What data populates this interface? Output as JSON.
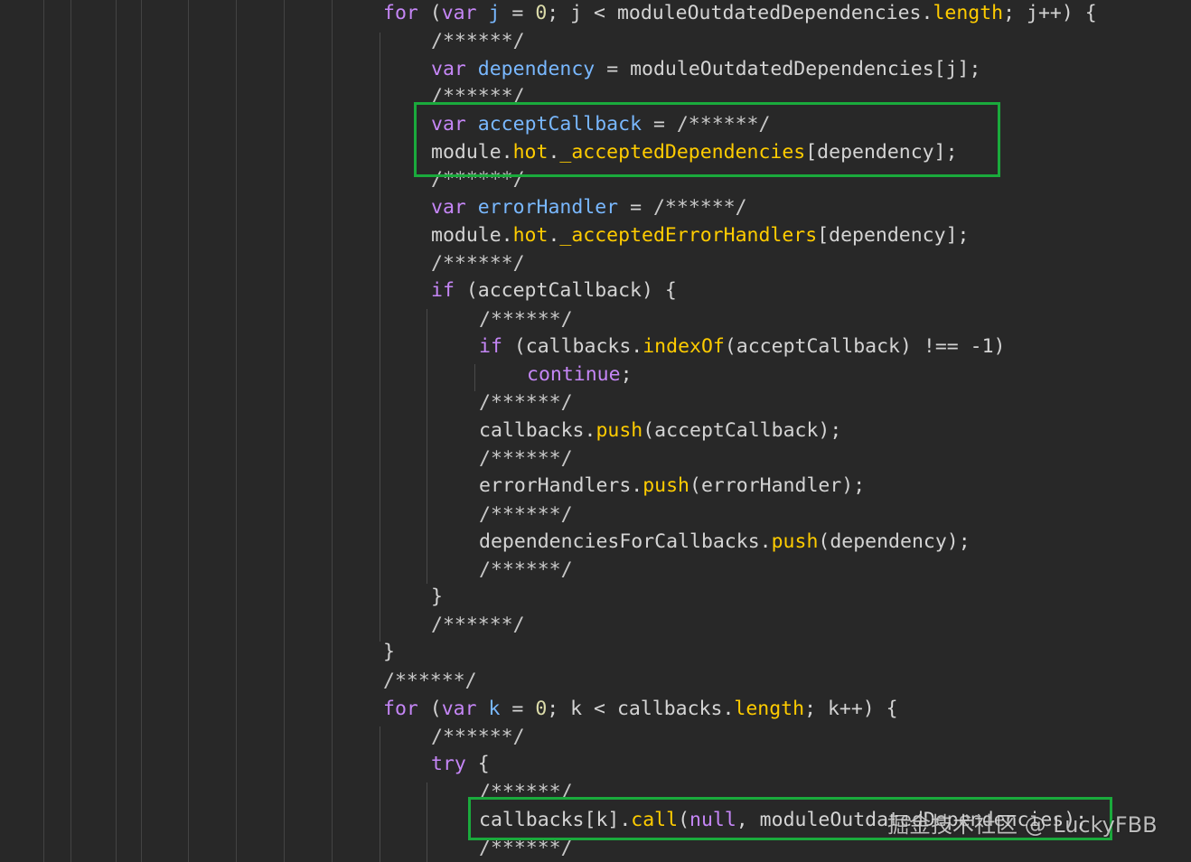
{
  "editor": {
    "lines": [
      {
        "tokens": [
          [
            "kw",
            "for"
          ],
          [
            "plain",
            " ("
          ],
          [
            "kw",
            "var"
          ],
          [
            "plain",
            " "
          ],
          [
            "var",
            "j"
          ],
          [
            "op",
            " = "
          ],
          [
            "num",
            "0"
          ],
          [
            "plain",
            "; j < moduleOutdatedDependencies."
          ],
          [
            "fn",
            "length"
          ],
          [
            "plain",
            "; j++) {"
          ]
        ]
      },
      {
        "tokens": [
          [
            "com",
            "/******/"
          ]
        ]
      },
      {
        "tokens": [
          [
            "kw",
            "var"
          ],
          [
            "plain",
            " "
          ],
          [
            "var",
            "dependency"
          ],
          [
            "op",
            " = "
          ],
          [
            "plain",
            "moduleOutdatedDependencies[j];"
          ]
        ]
      },
      {
        "tokens": [
          [
            "com",
            "/******/"
          ]
        ]
      },
      {
        "tokens": [
          [
            "kw",
            "var"
          ],
          [
            "plain",
            " "
          ],
          [
            "var",
            "acceptCallback"
          ],
          [
            "op",
            " = "
          ],
          [
            "com",
            "/******/"
          ]
        ]
      },
      {
        "tokens": [
          [
            "plain",
            "module."
          ],
          [
            "fn",
            "hot"
          ],
          [
            "plain",
            "."
          ],
          [
            "fn",
            "_acceptedDependencies"
          ],
          [
            "plain",
            "[dependency];"
          ]
        ]
      },
      {
        "tokens": [
          [
            "com",
            "/******/"
          ]
        ]
      },
      {
        "tokens": [
          [
            "kw",
            "var"
          ],
          [
            "plain",
            " "
          ],
          [
            "var",
            "errorHandler"
          ],
          [
            "op",
            " = "
          ],
          [
            "com",
            "/******/"
          ]
        ]
      },
      {
        "tokens": [
          [
            "plain",
            "module."
          ],
          [
            "fn",
            "hot"
          ],
          [
            "plain",
            "."
          ],
          [
            "fn",
            "_acceptedErrorHandlers"
          ],
          [
            "plain",
            "[dependency];"
          ]
        ]
      },
      {
        "tokens": [
          [
            "com",
            "/******/"
          ]
        ]
      },
      {
        "tokens": [
          [
            "kw",
            "if"
          ],
          [
            "plain",
            " (acceptCallback) {"
          ]
        ]
      },
      {
        "tokens": [
          [
            "com",
            "/******/"
          ]
        ]
      },
      {
        "tokens": [
          [
            "kw",
            "if"
          ],
          [
            "plain",
            " (callbacks."
          ],
          [
            "fn",
            "indexOf"
          ],
          [
            "plain",
            "(acceptCallback) !== -1)"
          ]
        ]
      },
      {
        "tokens": [
          [
            "kw",
            "continue"
          ],
          [
            "plain",
            ";"
          ]
        ]
      },
      {
        "tokens": [
          [
            "com",
            "/******/"
          ]
        ]
      },
      {
        "tokens": [
          [
            "plain",
            "callbacks."
          ],
          [
            "fn",
            "push"
          ],
          [
            "plain",
            "(acceptCallback);"
          ]
        ]
      },
      {
        "tokens": [
          [
            "com",
            "/******/"
          ]
        ]
      },
      {
        "tokens": [
          [
            "plain",
            "errorHandlers."
          ],
          [
            "fn",
            "push"
          ],
          [
            "plain",
            "(errorHandler);"
          ]
        ]
      },
      {
        "tokens": [
          [
            "com",
            "/******/"
          ]
        ]
      },
      {
        "tokens": [
          [
            "plain",
            "dependenciesForCallbacks."
          ],
          [
            "fn",
            "push"
          ],
          [
            "plain",
            "(dependency);"
          ]
        ]
      },
      {
        "tokens": [
          [
            "com",
            "/******/"
          ]
        ]
      },
      {
        "tokens": [
          [
            "plain",
            "}"
          ]
        ]
      },
      {
        "tokens": [
          [
            "com",
            "/******/"
          ]
        ]
      },
      {
        "tokens": [
          [
            "plain",
            "}"
          ]
        ]
      },
      {
        "tokens": [
          [
            "com",
            "/******/"
          ]
        ]
      },
      {
        "tokens": [
          [
            "kw",
            "for"
          ],
          [
            "plain",
            " ("
          ],
          [
            "kw",
            "var"
          ],
          [
            "plain",
            " "
          ],
          [
            "var",
            "k"
          ],
          [
            "op",
            " = "
          ],
          [
            "num",
            "0"
          ],
          [
            "plain",
            "; k < callbacks."
          ],
          [
            "fn",
            "length"
          ],
          [
            "plain",
            "; k++) {"
          ]
        ]
      },
      {
        "tokens": [
          [
            "com",
            "/******/"
          ]
        ]
      },
      {
        "tokens": [
          [
            "kw",
            "try"
          ],
          [
            "plain",
            " {"
          ]
        ]
      },
      {
        "tokens": [
          [
            "com",
            "/******/"
          ]
        ]
      },
      {
        "tokens": [
          [
            "plain",
            "callbacks[k]."
          ],
          [
            "fn",
            "call"
          ],
          [
            "plain",
            "("
          ],
          [
            "kw",
            "null"
          ],
          [
            "plain",
            ", moduleOutdatedDependencies);"
          ]
        ]
      },
      {
        "tokens": [
          [
            "com",
            "/******/"
          ]
        ]
      }
    ]
  },
  "highlights": [
    {
      "name": "highlight-accept-callback"
    },
    {
      "name": "highlight-callbacks-call"
    }
  ],
  "watermark": {
    "text": "掘金技术社区 @ LuckyFBB"
  },
  "colors": {
    "background": "#282828",
    "keyword": "#c586f6",
    "function": "#ffcc00",
    "variable": "#79b8ff",
    "highlight_border": "#1aaa3c"
  }
}
